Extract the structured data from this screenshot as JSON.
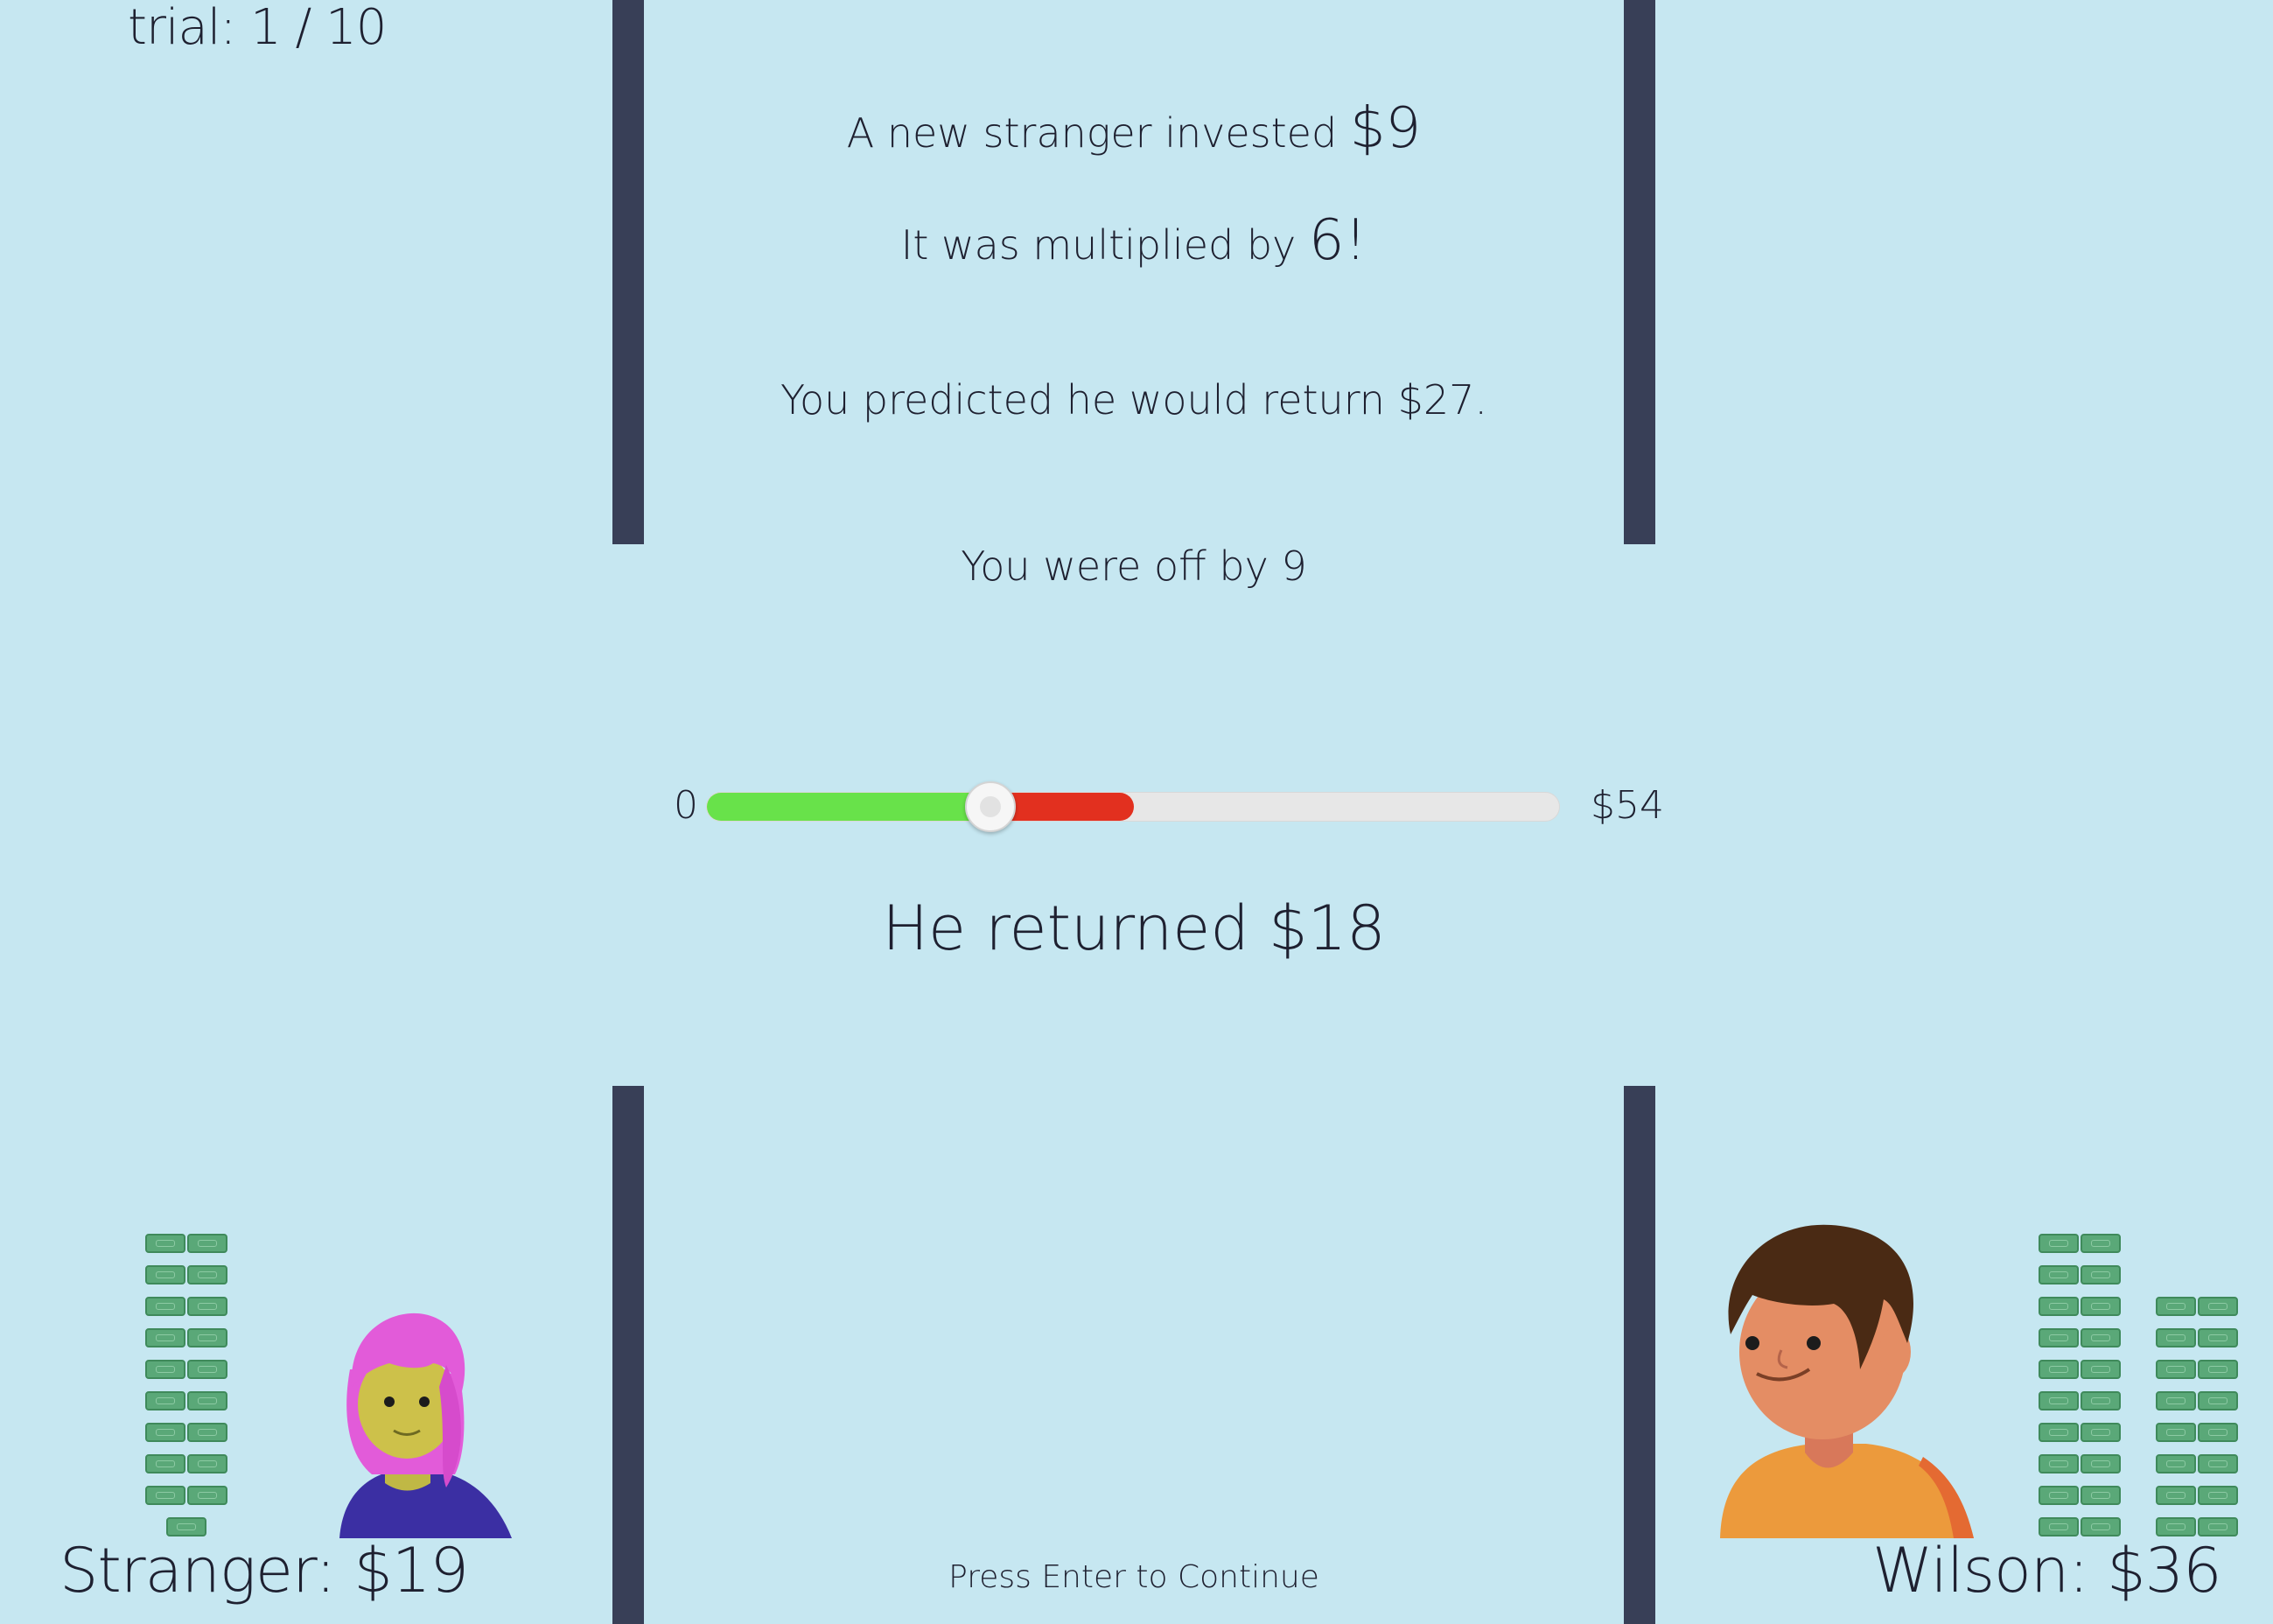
{
  "game": {
    "trial_label": "trial: 1 / 10",
    "invest_text": "A new stranger invested ",
    "invest_amount": "$9",
    "multiplier_text": "It was multiplied by ",
    "multiplier_value": "6!",
    "prediction_text": "You predicted he would return $27.",
    "offby_text": "You were off by 9",
    "slider": {
      "min_label": "0",
      "max_label": "$54",
      "min": 0,
      "max": 54,
      "returned": 18,
      "predicted": 27,
      "green_color": "#68e24a",
      "red_color": "#e2301f"
    },
    "returned_text": "He returned $18",
    "continue_text": "Press Enter to Continue"
  },
  "players": {
    "stranger": {
      "label": "Stranger: $19",
      "bill_stacks": [
        {
          "bills": 9
        },
        {
          "bills": 9
        },
        {
          "bills": 1
        }
      ]
    },
    "wilson": {
      "label": "Wilson: $36",
      "bill_stacks": [
        {
          "bills": 10
        },
        {
          "bills": 10
        },
        {
          "bills": 8
        },
        {
          "bills": 8
        }
      ]
    }
  },
  "colors": {
    "background": "#c6e7f1",
    "pillar": "#383f57",
    "bill": "#5aa878"
  }
}
